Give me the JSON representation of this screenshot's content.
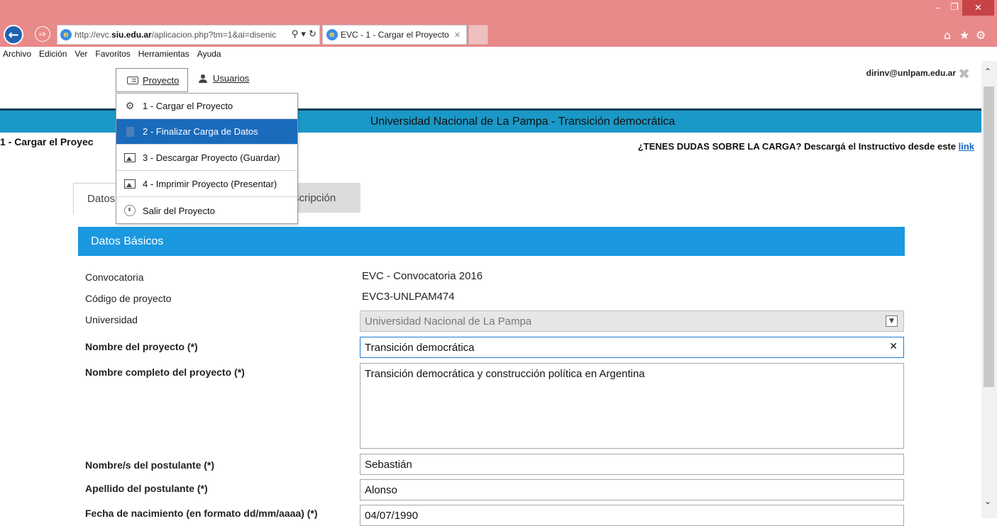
{
  "browser": {
    "url_prefix": "http://evc.",
    "url_domain": "siu.edu.ar",
    "url_rest": "/aplicacion.php?tm=1&ai=disenic",
    "tab_title": "EVC - 1 - Cargar el Proyecto",
    "menu": [
      "Archivo",
      "Edición",
      "Ver",
      "Favoritos",
      "Herramientas",
      "Ayuda"
    ]
  },
  "header": {
    "proyecto_label": "Proyecto",
    "usuarios_label": "Usuarios",
    "user_email": "dirinv@unlpam.edu.ar",
    "banner": "Universidad Nacional de La Pampa - Transición democrática",
    "page_title": "1 - Cargar el Proyec",
    "help_text": "¿TENES DUDAS SOBRE LA CARGA? Descargá el Instructivo desde este ",
    "help_link": "link"
  },
  "dropdown": {
    "items": [
      {
        "label": "1 - Cargar el Proyecto",
        "icon": "gear-icon"
      },
      {
        "label": "2 - Finalizar Carga de Datos",
        "icon": "document-icon"
      },
      {
        "label": "3 - Descargar Proyecto (Guardar)",
        "icon": "image-icon"
      },
      {
        "label": "4 - Imprimir Proyecto (Presentar)",
        "icon": "image-icon"
      },
      {
        "label": "Salir del Proyecto",
        "icon": "exit-icon"
      }
    ]
  },
  "tabs": {
    "datos": "Datos",
    "descripcion": "scripción"
  },
  "form": {
    "section_title": "Datos Básicos",
    "fields": {
      "convocatoria": {
        "label": "Convocatoria",
        "value": "EVC - Convocatoria 2016"
      },
      "codigo": {
        "label": "Código de proyecto",
        "value": "EVC3-UNLPAM474"
      },
      "universidad": {
        "label": "Universidad",
        "value": "Universidad Nacional de La Pampa"
      },
      "nombre": {
        "label": "Nombre del proyecto (*)",
        "value": "Transición democrática"
      },
      "nombre_completo": {
        "label": "Nombre completo del proyecto (*)",
        "value": "Transición democrática y construcción política en Argentina"
      },
      "nombre_postulante": {
        "label": "Nombre/s del postulante (*)",
        "value": "Sebastián"
      },
      "apellido": {
        "label": "Apellido del postulante (*)",
        "value": "Alonso"
      },
      "fecha_nac": {
        "label": "Fecha de nacimiento (en formato dd/mm/aaaa) (*)",
        "value": "04/07/1990"
      }
    }
  },
  "colors": {
    "titlebar": "#e8898a",
    "banner": "#1a98c7",
    "section_header": "#1a98e0",
    "menu_active": "#1a6bbc"
  }
}
